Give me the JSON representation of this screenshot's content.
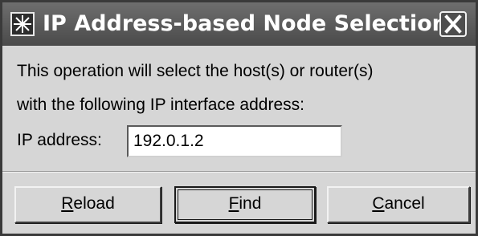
{
  "window": {
    "title": "IP Address-based Node Selection",
    "icon": "star-burst-icon",
    "close_icon": "close-icon"
  },
  "message": {
    "line1": "This operation will select the host(s) or router(s)",
    "line2": "with the following IP interface address:"
  },
  "ip_field": {
    "label": "IP address:",
    "value": "192.0.1.2"
  },
  "buttons": {
    "reload": {
      "mnemonic": "R",
      "rest": "eload"
    },
    "find": {
      "mnemonic": "F",
      "rest": "ind"
    },
    "cancel": {
      "mnemonic": "C",
      "rest": "ancel"
    }
  }
}
